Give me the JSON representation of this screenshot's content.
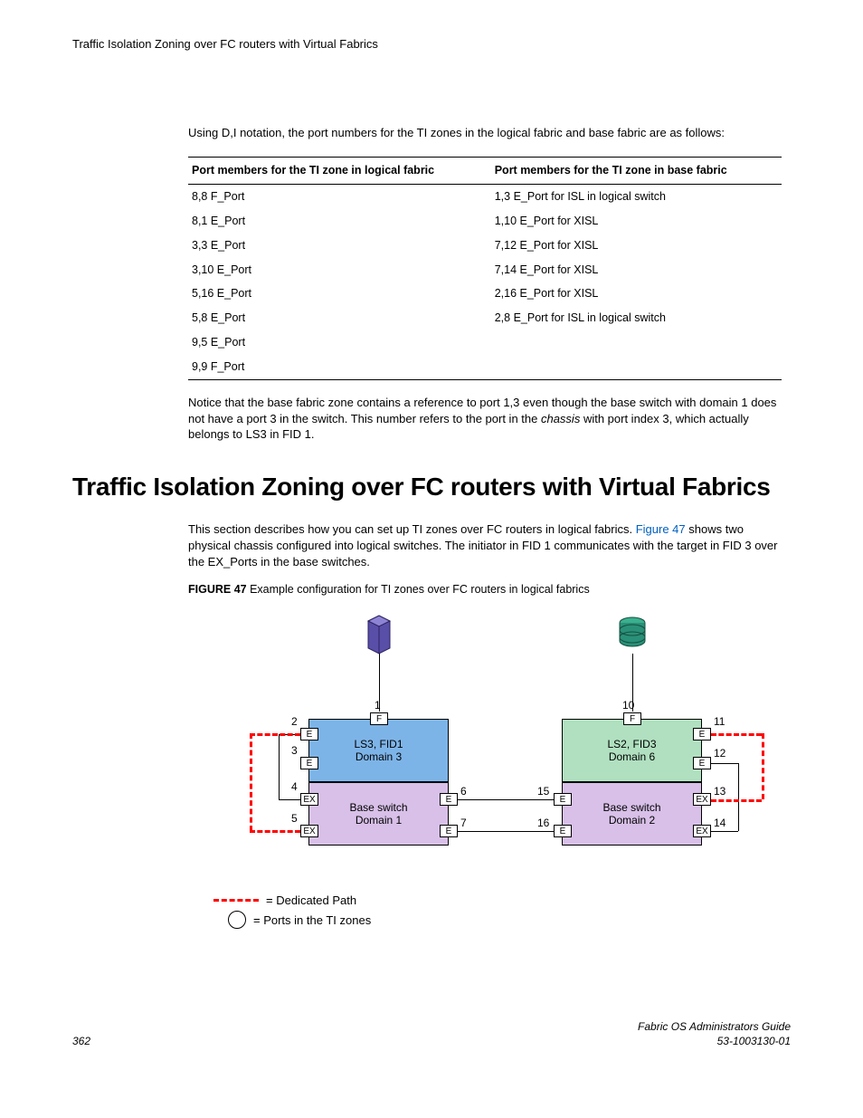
{
  "header": {
    "title": "Traffic Isolation Zoning over FC routers with Virtual Fabrics"
  },
  "intro": "Using D,I notation, the port numbers for the TI zones in the logical fabric and base fabric are as follows:",
  "table": {
    "headers": {
      "left": "Port members for the TI zone in logical fabric",
      "right": "Port members for the TI zone in base fabric"
    },
    "rows": [
      {
        "left": "8,8 F_Port",
        "right": "1,3 E_Port for ISL in logical switch"
      },
      {
        "left": "8,1 E_Port",
        "right": "1,10 E_Port for XISL"
      },
      {
        "left": "3,3 E_Port",
        "right": "7,12 E_Port for XISL"
      },
      {
        "left": "3,10 E_Port",
        "right": "7,14 E_Port for XISL"
      },
      {
        "left": "5,16 E_Port",
        "right": "2,16 E_Port for XISL"
      },
      {
        "left": "5,8 E_Port",
        "right": "2,8 E_Port for ISL in logical switch"
      },
      {
        "left": "9,5 E_Port",
        "right": ""
      },
      {
        "left": "9,9 F_Port",
        "right": ""
      }
    ]
  },
  "notice": {
    "part1": "Notice that the base fabric zone contains a reference to port 1,3 even though the base switch with domain 1 does not have a port 3 in the switch. This number refers to the port in the ",
    "ital": "chassis",
    "part2": " with port index 3, which actually belongs to LS3 in FID 1."
  },
  "section": {
    "title": "Traffic Isolation Zoning over FC routers with Virtual Fabrics",
    "para": {
      "p1": "This section describes how you can set up TI zones over FC routers in logical fabrics. ",
      "link": "Figure 47",
      "p2": " shows two physical chassis configured into logical switches. The initiator in FID 1 communicates with the target in FID 3 over the EX_Ports in the base switches."
    },
    "figcap": {
      "bold": "FIGURE 47",
      "rest": " Example configuration for TI zones over FC routers in logical fabrics"
    }
  },
  "figure": {
    "left_upper": {
      "l1": "LS3, FID1",
      "l2": "Domain 3"
    },
    "right_upper": {
      "l1": "LS2, FID3",
      "l2": "Domain 6"
    },
    "left_base": {
      "l1": "Base switch",
      "l2": "Domain 1"
    },
    "right_base": {
      "l1": "Base switch",
      "l2": "Domain 2"
    },
    "ports": {
      "p1": "1",
      "p2": "2",
      "p3": "3",
      "p4": "4",
      "p5": "5",
      "p6": "6",
      "p7": "7",
      "p10": "10",
      "p11": "11",
      "p12": "12",
      "p13": "13",
      "p14": "14",
      "p15": "15",
      "p16": "16"
    },
    "port_types": {
      "F": "F",
      "E": "E",
      "EX": "EX"
    },
    "legend": {
      "dedicated": "= Dedicated Path",
      "ports": "= Ports in the TI zones"
    }
  },
  "footer": {
    "page": "362",
    "guide": "Fabric OS Administrators Guide",
    "docnum": "53-1003130-01"
  }
}
